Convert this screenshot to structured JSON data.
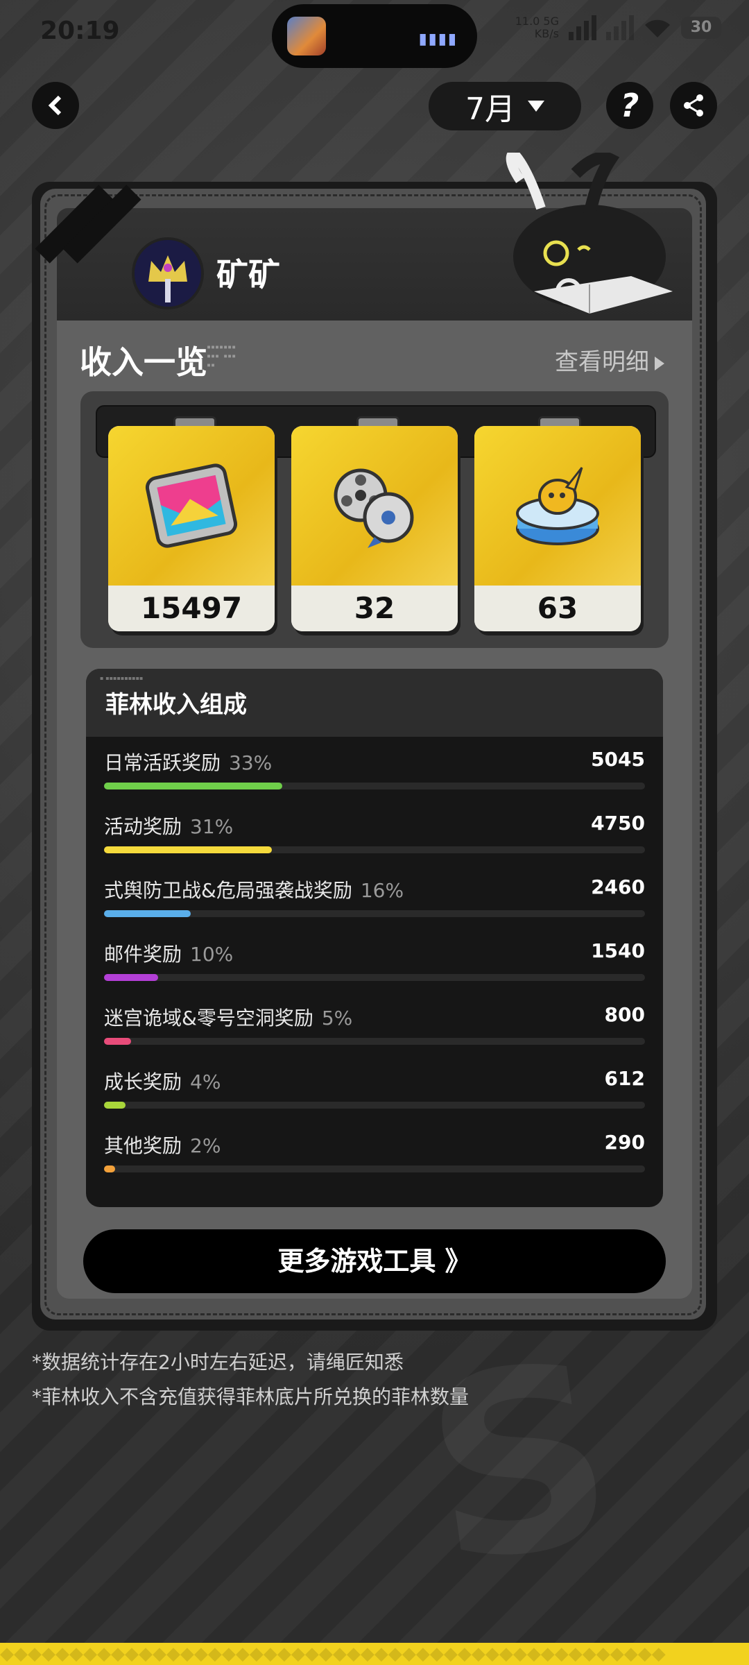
{
  "status_bar": {
    "time": "20:19",
    "net_speed": "11.0",
    "net_unit": "KB/s",
    "network": "5G",
    "battery": "30"
  },
  "nav": {
    "back_icon": "chevron-left-icon",
    "month": "7月",
    "help_icon": "question-icon",
    "share_icon": "share-icon"
  },
  "profile": {
    "username": "矿矿"
  },
  "income_overview": {
    "title": "收入一览",
    "detail_link": "查看明细",
    "items": [
      {
        "icon": "film-reel-icon",
        "value": "15497"
      },
      {
        "icon": "film-reels-icon",
        "value": "32"
      },
      {
        "icon": "bangboo-token-icon",
        "value": "63"
      }
    ]
  },
  "composition": {
    "title": "菲林收入组成",
    "rows": [
      {
        "label": "日常活跃奖励",
        "percent": "33%",
        "value": "5045",
        "fraction": 0.33,
        "color": "#6fcf4a"
      },
      {
        "label": "活动奖励",
        "percent": "31%",
        "value": "4750",
        "fraction": 0.31,
        "color": "#f5da3c"
      },
      {
        "label": "式舆防卫战&危局强袭战奖励",
        "percent": "16%",
        "value": "2460",
        "fraction": 0.16,
        "color": "#5aaeea"
      },
      {
        "label": "邮件奖励",
        "percent": "10%",
        "value": "1540",
        "fraction": 0.1,
        "color": "#b33fd6"
      },
      {
        "label": "迷宫诡域&零号空洞奖励",
        "percent": "5%",
        "value": "800",
        "fraction": 0.05,
        "color": "#e84c7a"
      },
      {
        "label": "成长奖励",
        "percent": "4%",
        "value": "612",
        "fraction": 0.04,
        "color": "#a9d63a"
      },
      {
        "label": "其他奖励",
        "percent": "2%",
        "value": "290",
        "fraction": 0.02,
        "color": "#f3a13a"
      }
    ]
  },
  "more_tools": {
    "label": "更多游戏工具 》"
  },
  "notes": [
    "*数据统计存在2小时左右延迟，请绳匠知悉",
    "*菲林收入不含充值获得菲林底片所兑换的菲林数量"
  ]
}
